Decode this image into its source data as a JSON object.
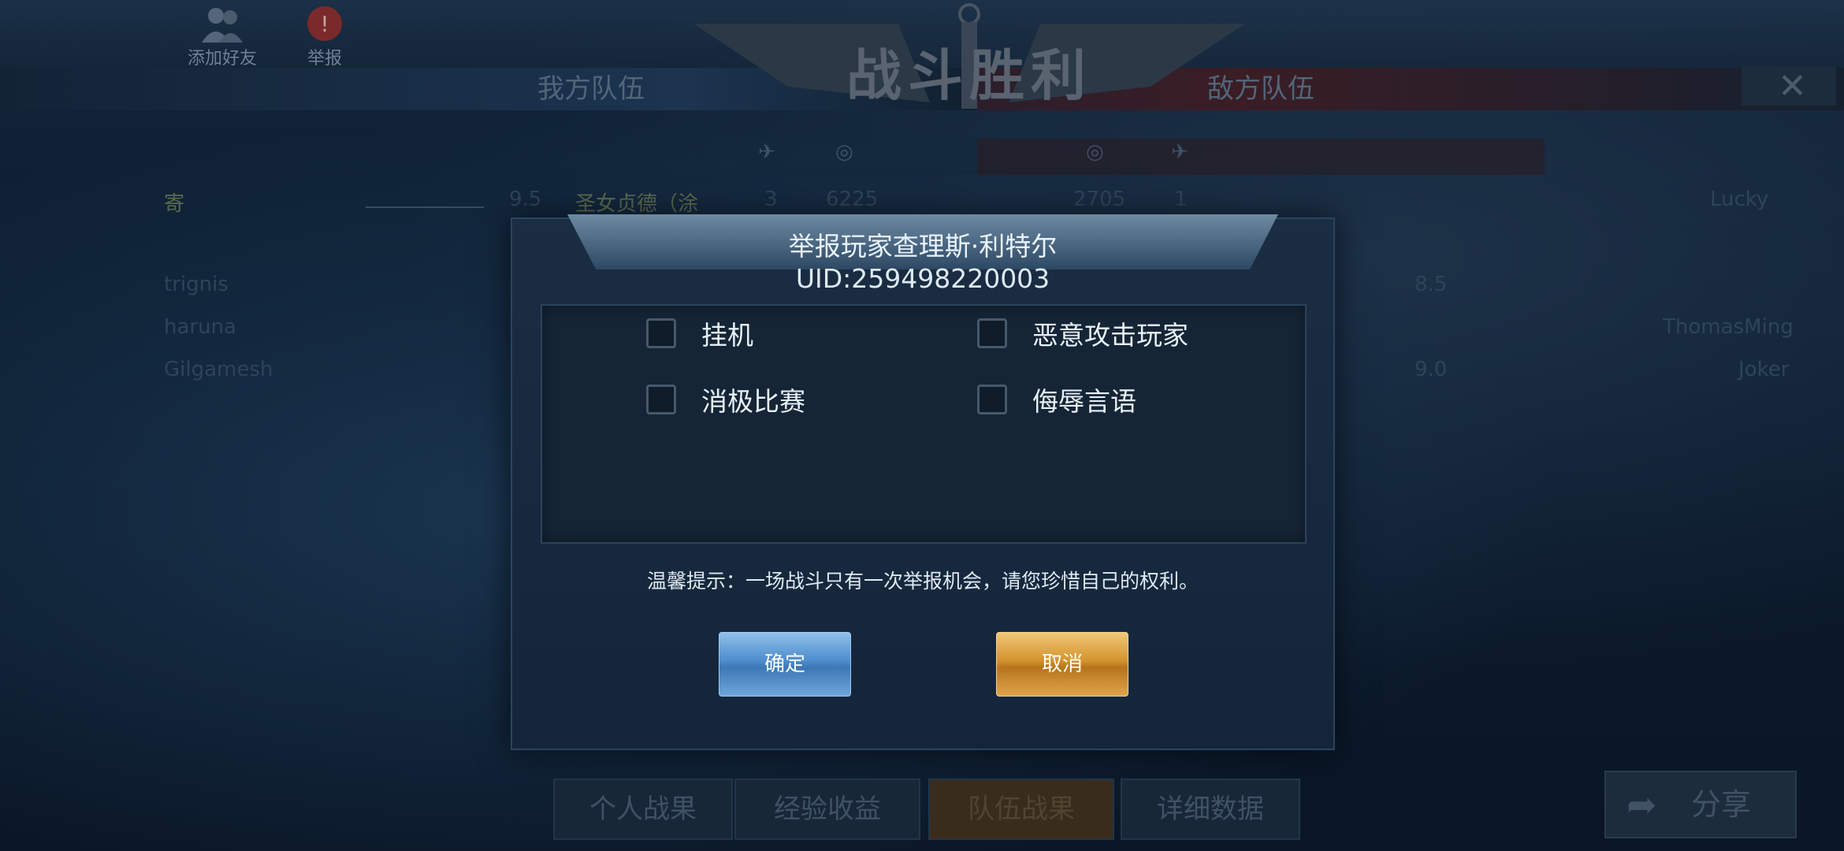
{
  "top_buttons": {
    "add_friend": "添加好友",
    "report": "举报"
  },
  "battle_title": "战斗胜利",
  "my_team": "我方队伍",
  "enemy_team": "敌方队伍",
  "rows_visible": {
    "r1_name": "寄",
    "r1_score": "9.5",
    "r1_ship": "圣女贞德（涂",
    "r1_kills": "3",
    "r1_damage": "6225",
    "r1_enemy_damage": "2705",
    "r1_enemy_kills": "1",
    "r3_name": "trignis",
    "r4_name": "haruna",
    "r5_name": "Gilgamesh",
    "e1_name": "Lucky",
    "e4_name": "ThomasMing",
    "e5_name": "Joker",
    "e5_score": "9.0",
    "e3_score": "8.5"
  },
  "dialog": {
    "title": "举报玩家查理斯·利特尔",
    "uid": "UID:259498220003",
    "options": [
      "挂机",
      "恶意攻击玩家",
      "消极比赛",
      "侮辱言语"
    ],
    "tip": "温馨提示：一场战斗只有一次举报机会，请您珍惜自己的权利。",
    "confirm": "确定",
    "cancel": "取消"
  },
  "tabs": [
    "个人战果",
    "经验收益",
    "队伍战果",
    "详细数据"
  ],
  "share": "分享"
}
